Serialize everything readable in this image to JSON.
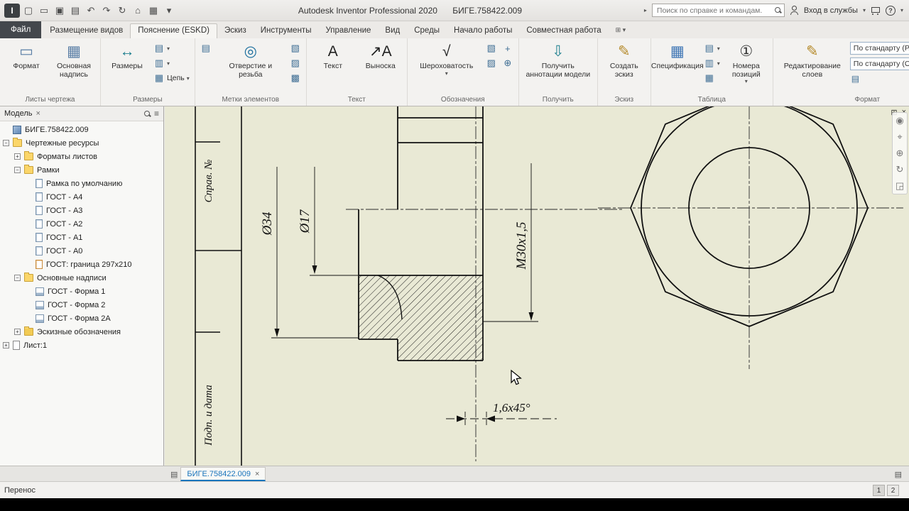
{
  "glyphs": {
    "close": "×",
    "caret": "▾",
    "help": "?",
    "list": "≡",
    "restore": "⊞",
    "forward": "▸",
    "page": "▤"
  },
  "titlebar": {
    "app_title": "Autodesk Inventor Professional 2020",
    "doc_title": "БИГЕ.758422.009",
    "search_placeholder": "Поиск по справке и командам.",
    "signin_label": "Вход в службы",
    "qat_icons": [
      {
        "name": "app-logo-icon",
        "glyph": "I"
      },
      {
        "name": "new-file-icon",
        "glyph": "▢"
      },
      {
        "name": "open-icon",
        "glyph": "▭"
      },
      {
        "name": "save-icon",
        "glyph": "▣"
      },
      {
        "name": "print-icon",
        "glyph": "▤"
      },
      {
        "name": "undo-icon",
        "glyph": "↶"
      },
      {
        "name": "redo-icon",
        "glyph": "↷"
      },
      {
        "name": "update-icon",
        "glyph": "↻"
      },
      {
        "name": "home-icon",
        "glyph": "⌂"
      },
      {
        "name": "sheet-format-icon",
        "glyph": "▦"
      },
      {
        "name": "qat-menu-icon",
        "glyph": "▾"
      }
    ]
  },
  "ribbon": {
    "tabs": [
      "Файл",
      "Размещение видов",
      "Пояснение (ESKD)",
      "Эскиз",
      "Инструменты",
      "Управление",
      "Вид",
      "Среды",
      "Начало работы",
      "Совместная работа"
    ],
    "active_tab": "Пояснение (ESKD)",
    "file_tab": "Файл",
    "panels": [
      {
        "label": "Листы чертежа",
        "items": [
          {
            "type": "big",
            "label": "Формат",
            "icon": "format-sheet-icon",
            "glyph": "▭",
            "color": "#5b7fa6"
          },
          {
            "type": "big",
            "label": "Основная надпись",
            "icon": "title-block-icon",
            "glyph": "▦",
            "color": "#5b7fa6"
          }
        ]
      },
      {
        "label": "Размеры",
        "items": [
          {
            "type": "big",
            "label": "Размеры",
            "icon": "dimension-icon",
            "glyph": "↔",
            "color": "#1d7f8e"
          },
          {
            "type": "stack",
            "rows": [
              {
                "icon": "ordinate-dimension-icon",
                "glyph": "▤",
                "arrow": true
              },
              {
                "icon": "baseline-dimension-icon",
                "glyph": "▥",
                "arrow": true
              },
              {
                "icon": "chain-dimension-icon",
                "glyph": "▦",
                "label": "Цепь",
                "arrow": true
              }
            ]
          }
        ]
      },
      {
        "label": "Метки элементов",
        "items": [
          {
            "type": "stack",
            "rows": [
              {
                "icon": "thread-note-icon",
                "glyph": "▤"
              }
            ]
          },
          {
            "type": "big",
            "label": "Отверстие и резьба",
            "icon": "hole-thread-note-icon",
            "glyph": "◎",
            "color": "#1d6f9e",
            "wide": true
          },
          {
            "type": "stack",
            "rows": [
              {
                "icon": "chamfer-note-icon",
                "glyph": "▧"
              },
              {
                "icon": "punch-note-icon",
                "glyph": "▨"
              },
              {
                "icon": "bend-note-icon",
                "glyph": "▩"
              }
            ]
          }
        ]
      },
      {
        "label": "Текст",
        "items": [
          {
            "type": "big",
            "label": "Текст",
            "icon": "text-icon",
            "glyph": "А",
            "color": "#222"
          },
          {
            "type": "big",
            "label": "Выноска",
            "icon": "leader-text-icon",
            "glyph": "↗А",
            "color": "#222"
          }
        ]
      },
      {
        "label": "Обозначения",
        "items": [
          {
            "type": "big",
            "label": "Шероховатость",
            "icon": "surface-finish-icon",
            "glyph": "√",
            "color": "#222",
            "arrow": true,
            "wide": true
          },
          {
            "type": "stack",
            "rows": [
              {
                "icon": "weld-symbol-icon",
                "glyph": "▧"
              },
              {
                "icon": "edge-symbol-icon",
                "glyph": "▨"
              }
            ]
          },
          {
            "type": "stack",
            "rows": [
              {
                "icon": "datum-target-icon",
                "glyph": "+"
              },
              {
                "icon": "feature-frame-icon",
                "glyph": "⊕"
              }
            ]
          }
        ]
      },
      {
        "label": "Получить",
        "items": [
          {
            "type": "big",
            "label": "Получить аннотации модели",
            "icon": "get-model-annotations-icon",
            "glyph": "⇩",
            "color": "#1d7f8e",
            "wide": true
          }
        ]
      },
      {
        "label": "Эскиз",
        "items": [
          {
            "type": "big",
            "label": "Создать эскиз",
            "icon": "create-sketch-icon",
            "glyph": "✎",
            "color": "#b58a2a"
          }
        ]
      },
      {
        "label": "Таблица",
        "items": [
          {
            "type": "big",
            "label": "Спецификация",
            "icon": "parts-list-icon",
            "glyph": "▦",
            "color": "#3f76b5"
          },
          {
            "type": "stack",
            "rows": [
              {
                "icon": "general-table-icon",
                "glyph": "▤",
                "arrow": true
              },
              {
                "icon": "hole-table-icon",
                "glyph": "▥",
                "arrow": true
              },
              {
                "icon": "revision-table-icon",
                "glyph": "▦"
              }
            ]
          },
          {
            "type": "big",
            "label": "Номера позиций",
            "icon": "balloon-icon",
            "glyph": "①",
            "color": "#333",
            "arrow": true
          }
        ]
      },
      {
        "label": "Формат",
        "items": [
          {
            "type": "big",
            "label": "Редактирование слоев",
            "icon": "edit-layers-icon",
            "glyph": "✎",
            "color": "#b58a2a",
            "wide": true
          },
          {
            "type": "combos",
            "combos": [
              {
                "value": "По стандарту (Р...",
                "icon": "layer-style-combo-icon"
              },
              {
                "value": "По стандарту (Обы...",
                "icon": "object-style-combo-icon"
              }
            ],
            "extra_icon": {
              "icon": "style-flush-icon",
              "glyph": "▤"
            }
          }
        ]
      }
    ]
  },
  "browser": {
    "header_title": "Модель",
    "tree": [
      {
        "label": "БИГЕ.758422.009",
        "depth": 0,
        "icon": "document"
      },
      {
        "label": "Чертежные ресурсы",
        "depth": 0,
        "expand": "minus",
        "icon": "folder"
      },
      {
        "label": "Форматы листов",
        "depth": 1,
        "expand": "plus",
        "icon": "folder"
      },
      {
        "label": "Рамки",
        "depth": 1,
        "expand": "minus",
        "icon": "folder"
      },
      {
        "label": "Рамка по умолчанию",
        "depth": 2,
        "icon": "frame"
      },
      {
        "label": "ГОСТ - А4",
        "depth": 2,
        "icon": "frame"
      },
      {
        "label": "ГОСТ - А3",
        "depth": 2,
        "icon": "frame"
      },
      {
        "label": "ГОСТ - А2",
        "depth": 2,
        "icon": "frame"
      },
      {
        "label": "ГОСТ - А1",
        "depth": 2,
        "icon": "frame"
      },
      {
        "label": "ГОСТ - А0",
        "depth": 2,
        "icon": "frame"
      },
      {
        "label": "ГОСТ: граница 297x210",
        "depth": 2,
        "icon": "frame-alt"
      },
      {
        "label": "Основные надписи",
        "depth": 1,
        "expand": "minus",
        "icon": "folder"
      },
      {
        "label": "ГОСТ - Форма 1",
        "depth": 2,
        "icon": "titleblock"
      },
      {
        "label": "ГОСТ - Форма 2",
        "depth": 2,
        "icon": "titleblock"
      },
      {
        "label": "ГОСТ - Форма 2А",
        "depth": 2,
        "icon": "titleblock"
      },
      {
        "label": "Эскизные обозначения",
        "depth": 1,
        "expand": "plus",
        "icon": "folder-sketch"
      },
      {
        "label": "Лист:1",
        "depth": 0,
        "expand": "plus",
        "icon": "sheet"
      }
    ]
  },
  "drawing": {
    "dim_outer": "Ø34",
    "dim_bore": "Ø17",
    "dim_thread": "М30х1,5",
    "dim_chamfer": "1,6х45°",
    "frame_label_ref": "Справ. №",
    "frame_label_sign": "Подп. и дата"
  },
  "canvas": {
    "nav_icons": [
      {
        "name": "steering-wheel-icon",
        "glyph": "◉"
      },
      {
        "name": "pan-icon",
        "glyph": "⌖"
      },
      {
        "name": "zoom-icon",
        "glyph": "⊕"
      },
      {
        "name": "orbit-icon",
        "glyph": "↻"
      },
      {
        "name": "zoom-window-icon",
        "glyph": "◲"
      }
    ]
  },
  "sheet_bar": {
    "tab_label": "БИГЕ.758422.009"
  },
  "statusbar": {
    "hint": "Перенос",
    "pages": [
      "1",
      "2"
    ]
  }
}
